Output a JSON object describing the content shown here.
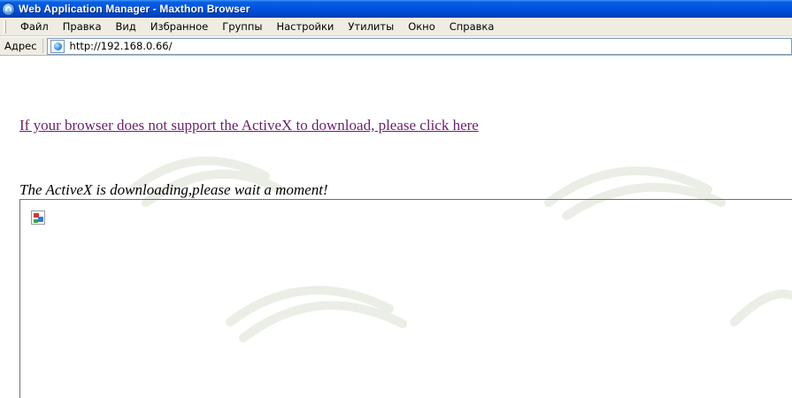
{
  "window": {
    "title": "Web Application Manager - Maxthon Browser"
  },
  "menu": {
    "items": [
      "Файл",
      "Правка",
      "Вид",
      "Избранное",
      "Группы",
      "Настройки",
      "Утилиты",
      "Окно",
      "Справка"
    ]
  },
  "address_bar": {
    "label": "Адрес",
    "url": "http://192.168.0.66/"
  },
  "page": {
    "download_link": "If your browser does not support the ActiveX to download, please click here",
    "status_message": "The ActiveX is downloading,please wait a moment!"
  },
  "colors": {
    "title_bar": "#0054e3",
    "link": "#6b1f6f"
  },
  "icons": {
    "app": "maxthon-logo-icon",
    "address": "page-globe-icon",
    "placeholder": "broken-image-icon"
  }
}
